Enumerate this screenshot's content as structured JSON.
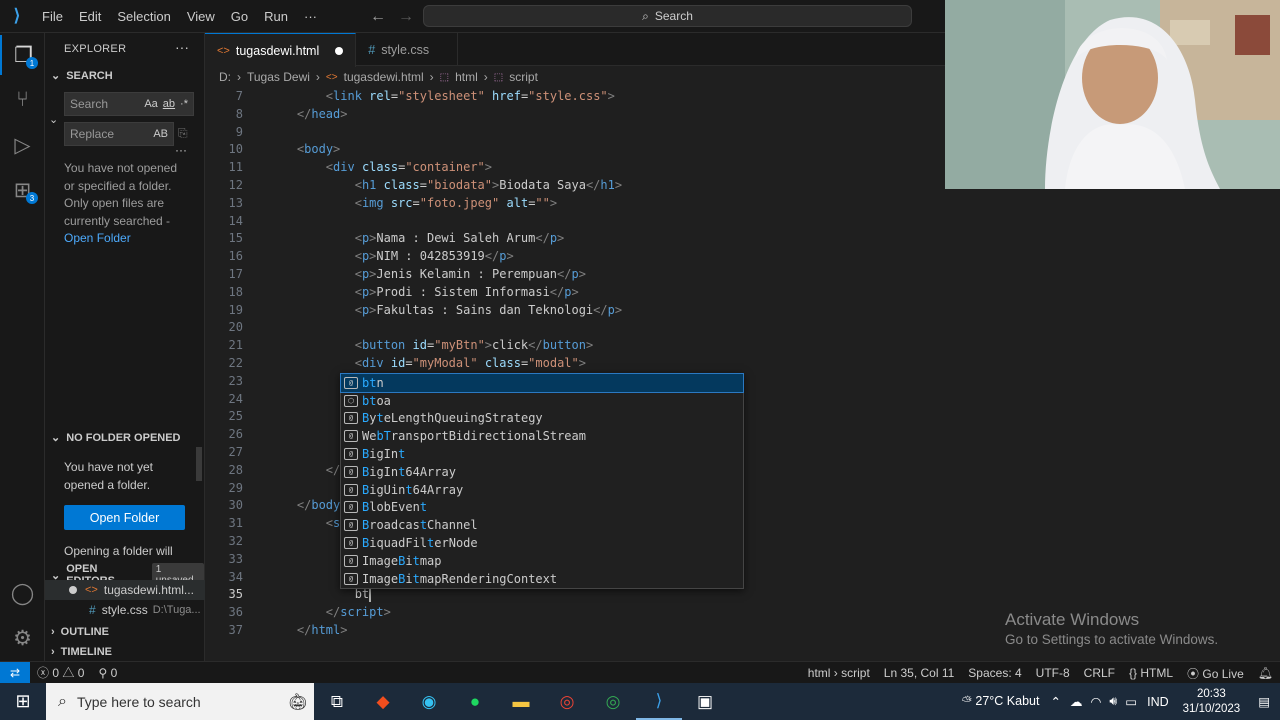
{
  "menu": [
    "File",
    "Edit",
    "Selection",
    "View",
    "Go",
    "Run",
    "···"
  ],
  "search_box": "Search",
  "sidebar": {
    "title": "EXPLORER",
    "search_section": "SEARCH",
    "search_placeholder": "Search",
    "replace_placeholder": "Replace",
    "search_opts": [
      "Aa",
      "ab",
      "·*"
    ],
    "replace_opt": "AB",
    "search_msg": "You have not opened or specified a folder. Only open files are currently searched -",
    "open_folder_link": "Open Folder",
    "no_folder_section": "NO FOLDER OPENED",
    "no_folder_msg": "You have not yet opened a folder.",
    "open_folder_button": "Open Folder",
    "opening_msg": "Opening a folder will",
    "open_editors_section": "OPEN EDITORS",
    "unsaved_badge": "1 unsaved",
    "open_editors": [
      {
        "name": "tugasdewi.html..."
      },
      {
        "name": "style.css",
        "path": "D:\\Tuga..."
      }
    ],
    "outline_section": "OUTLINE",
    "timeline_section": "TIMELINE"
  },
  "badges": {
    "explorer": "1",
    "extensions": "3"
  },
  "tabs": [
    {
      "label": "tugasdewi.html"
    },
    {
      "label": "style.css"
    }
  ],
  "breadcrumb": [
    "D:",
    "Tugas Dewi",
    "tugasdewi.html",
    "html",
    "script"
  ],
  "code_lines": [
    {
      "n": "7",
      "html": "        <span class='g'>&lt;</span><span class='t'>link</span> <span class='a'>rel</span>=<span class='s'>\"stylesheet\"</span> <span class='a'>href</span>=<span class='s'>\"style.css\"</span><span class='g'>&gt;</span>"
    },
    {
      "n": "8",
      "html": "    <span class='g'>&lt;/</span><span class='t'>head</span><span class='g'>&gt;</span>"
    },
    {
      "n": "9",
      "html": ""
    },
    {
      "n": "10",
      "html": "    <span class='g'>&lt;</span><span class='t'>body</span><span class='g'>&gt;</span>"
    },
    {
      "n": "11",
      "html": "        <span class='g'>&lt;</span><span class='t'>div</span> <span class='a'>class</span>=<span class='s'>\"container\"</span><span class='g'>&gt;</span>"
    },
    {
      "n": "12",
      "html": "            <span class='g'>&lt;</span><span class='t'>h1</span> <span class='a'>class</span>=<span class='s'>\"biodata\"</span><span class='g'>&gt;</span>Biodata Saya<span class='g'>&lt;/</span><span class='t'>h1</span><span class='g'>&gt;</span>"
    },
    {
      "n": "13",
      "html": "            <span class='g'>&lt;</span><span class='t'>img</span> <span class='a'>src</span>=<span class='s'>\"foto.jpeg\"</span> <span class='a'>alt</span>=<span class='s'>\"\"</span><span class='g'>&gt;</span>"
    },
    {
      "n": "14",
      "html": ""
    },
    {
      "n": "15",
      "html": "            <span class='g'>&lt;</span><span class='t'>p</span><span class='g'>&gt;</span>Nama : Dewi Saleh Arum<span class='g'>&lt;/</span><span class='t'>p</span><span class='g'>&gt;</span>"
    },
    {
      "n": "16",
      "html": "            <span class='g'>&lt;</span><span class='t'>p</span><span class='g'>&gt;</span>NIM : 042853919<span class='g'>&lt;/</span><span class='t'>p</span><span class='g'>&gt;</span>"
    },
    {
      "n": "17",
      "html": "            <span class='g'>&lt;</span><span class='t'>p</span><span class='g'>&gt;</span>Jenis Kelamin : Perempuan<span class='g'>&lt;/</span><span class='t'>p</span><span class='g'>&gt;</span>"
    },
    {
      "n": "18",
      "html": "            <span class='g'>&lt;</span><span class='t'>p</span><span class='g'>&gt;</span>Prodi : Sistem Informasi<span class='g'>&lt;/</span><span class='t'>p</span><span class='g'>&gt;</span>"
    },
    {
      "n": "19",
      "html": "            <span class='g'>&lt;</span><span class='t'>p</span><span class='g'>&gt;</span>Fakultas : Sains dan Teknologi<span class='g'>&lt;/</span><span class='t'>p</span><span class='g'>&gt;</span>"
    },
    {
      "n": "20",
      "html": ""
    },
    {
      "n": "21",
      "html": "            <span class='g'>&lt;</span><span class='t'>button</span> <span class='a'>id</span>=<span class='s'>\"myBtn\"</span><span class='g'>&gt;</span>click<span class='g'>&lt;/</span><span class='t'>button</span><span class='g'>&gt;</span>"
    },
    {
      "n": "22",
      "html": "            <span class='g'>&lt;</span><span class='t'>div</span> <span class='a'>id</span>=<span class='s'>\"myModal\"</span> <span class='a'>class</span>=<span class='s'>\"modal\"</span><span class='g'>&gt;</span>"
    },
    {
      "n": "23",
      "html": "                <span class='g'>&lt;</span>"
    },
    {
      "n": "24",
      "html": "                <span class='g'>&lt;</span>"
    },
    {
      "n": "25",
      "html": "                <span class='g'>&lt;</span>                                        a<span class='g'>&lt;/</span><span class='t'>h3</span><span class='g'>&gt;</span>"
    },
    {
      "n": "26",
      "html": "                <span class='g'>&lt;</span>"
    },
    {
      "n": "27",
      "html": "            <span class='g'>&lt;/</span>"
    },
    {
      "n": "28",
      "html": "        <span class='g'>&lt;/</span><span class='t'>div</span><span class='g'>&gt;</span>"
    },
    {
      "n": "29",
      "html": ""
    },
    {
      "n": "30",
      "html": "    <span class='g'>&lt;/</span><span class='t'>body</span><span class='g'>&gt;</span>"
    },
    {
      "n": "31",
      "html": "        <span class='g'>&lt;</span><span class='t'>scrip</span>"
    },
    {
      "n": "32",
      "html": "            <span class='v'>va</span>"
    },
    {
      "n": "33",
      "html": "            <span class='v'>va</span>"
    },
    {
      "n": "34",
      "html": "            <span class='v'>va</span>"
    },
    {
      "n": "35",
      "html": "            bt"
    },
    {
      "n": "36",
      "html": "        <span class='g'>&lt;/</span><span class='t'>script</span><span class='g'>&gt;</span>"
    },
    {
      "n": "37",
      "html": "    <span class='g'>&lt;/</span><span class='t'>html</span><span class='g'>&gt;</span>"
    }
  ],
  "suggestions": [
    {
      "html": "<b>bt</b>n",
      "icon": "[@]"
    },
    {
      "html": "<b>bt</b>oa",
      "icon": "⬡"
    },
    {
      "html": "<b>B</b>y<b>t</b>eLengthQueuingStrategy",
      "icon": "[@]"
    },
    {
      "html": "We<b>bT</b>ransportBidirectionalStream",
      "icon": "[@]"
    },
    {
      "html": "<b>B</b>igIn<b>t</b>",
      "icon": "[@]"
    },
    {
      "html": "<b>B</b>igIn<b>t</b>64Array",
      "icon": "[@]"
    },
    {
      "html": "<b>B</b>igUin<b>t</b>64Array",
      "icon": "[@]"
    },
    {
      "html": "<b>B</b>lobEven<b>t</b>",
      "icon": "[@]"
    },
    {
      "html": "<b>B</b>roadcas<b>t</b>Channel",
      "icon": "[@]"
    },
    {
      "html": "<b>B</b>iquadFil<b>t</b>erNode",
      "icon": "[@]"
    },
    {
      "html": "Image<b>B</b>i<b>t</b>map",
      "icon": "[@]"
    },
    {
      "html": "Image<b>B</b>i<b>t</b>mapRenderingContext",
      "icon": "[@]"
    }
  ],
  "watermark": {
    "line1": "Activate Windows",
    "line2": "Go to Settings to activate Windows."
  },
  "status": {
    "errors": "0",
    "warnings": "0",
    "ports": "0",
    "scope": "html › script",
    "position": "Ln 35, Col 11",
    "spaces": "Spaces: 4",
    "encoding": "UTF-8",
    "eol": "CRLF",
    "language": "HTML",
    "golive": "Go Live"
  },
  "taskbar": {
    "search_placeholder": "Type here to search",
    "weather": "27°C  Kabut",
    "lang": "IND",
    "time": "20:33",
    "date": "31/10/2023"
  },
  "colors": {
    "accent": "#0078d4",
    "link": "#4daafc",
    "tag": "#569cd6",
    "string": "#ce9178",
    "attr": "#9cdcfe",
    "match": "#2aaaff"
  }
}
